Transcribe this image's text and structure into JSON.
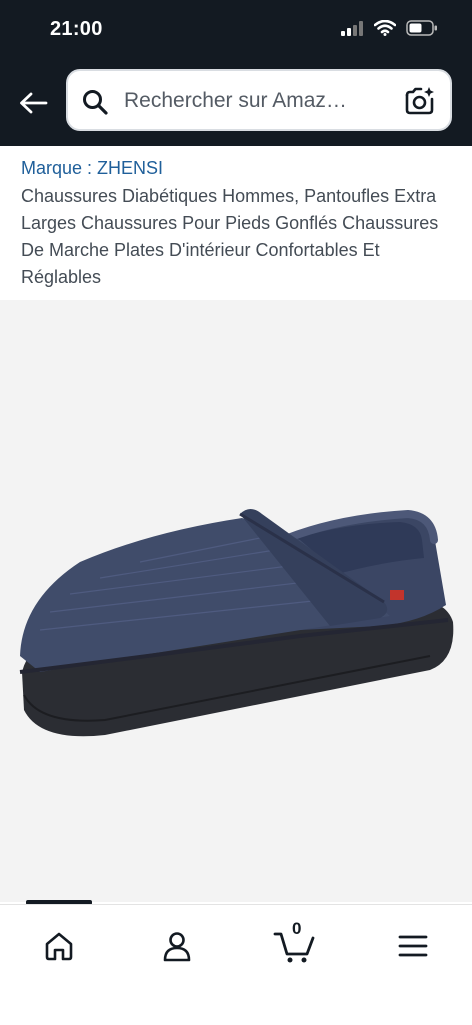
{
  "status_bar": {
    "time": "21:00"
  },
  "header": {
    "search_placeholder": "Rechercher sur Amaz…",
    "icons": {
      "back": "arrow-left-icon",
      "search": "magnifier-icon",
      "camera": "camera-scan-icon"
    }
  },
  "product": {
    "brand": "Marque : ZHENSI",
    "title": "Chaussures Diabétiques Hommes, Pantoufles Extra Larges Chaussures Pour Pieds Gonflés Chaussures De Marche Plates D'intérieur Confortables Et Réglables"
  },
  "tab_bar": {
    "cart_count": "0",
    "tabs": [
      "home-icon",
      "account-icon",
      "cart-icon",
      "menu-icon"
    ]
  },
  "colors": {
    "header_bg": "#131a22",
    "brand_link": "#1f5f9a",
    "shoe_blue": "#3d4a68"
  }
}
